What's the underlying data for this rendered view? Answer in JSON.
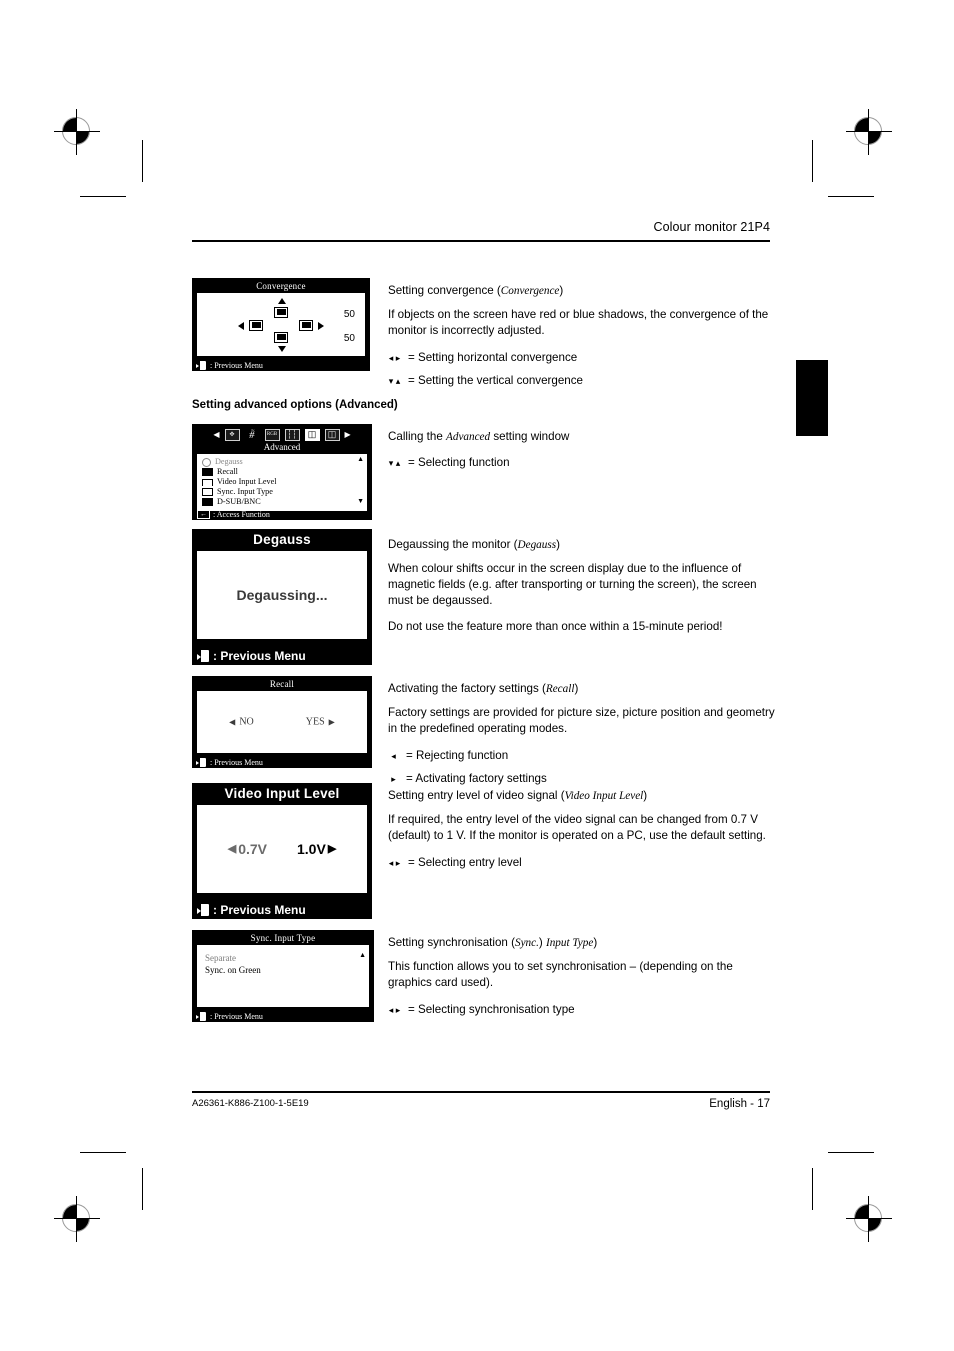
{
  "header": {
    "title": "Colour monitor 21P4"
  },
  "footer": {
    "part_number": "A26361-K886-Z100-1-5E19",
    "page_label": "English - 17"
  },
  "section_heading": "Setting advanced options (Advanced)",
  "sections": [
    {
      "id": "convergence",
      "osd": {
        "title": "Convergence",
        "value_top": "50",
        "value_bottom": "50",
        "footer": ": Previous Menu"
      },
      "heading_plain": "Setting convergence (",
      "heading_italic": "Convergence",
      "heading_close": ")",
      "body": "If objects on the screen have red or blue shadows, the convergence of the monitor is incorrectly adjusted.",
      "keys": [
        {
          "glyphs": "◂ ▸",
          "text": "= Setting horizontal convergence"
        },
        {
          "glyphs": "▾ ▴",
          "text": "= Setting the vertical convergence"
        }
      ]
    },
    {
      "id": "advanced",
      "osd": {
        "menu_label": "Advanced",
        "icons": [
          "left-arrow-icon",
          "picture-size-icon",
          "picture-position-icon",
          "rgb-colour-icon",
          "moire-icon",
          "advanced-icon",
          "osd-position-icon",
          "right-arrow-icon"
        ],
        "icon_glyphs": [
          "◀",
          "✥",
          "✤",
          "RGB",
          "⦀",
          "◰",
          "◳",
          "▶"
        ],
        "items": [
          {
            "label": "Degauss",
            "selected": false
          },
          {
            "label": "Recall",
            "selected": true
          },
          {
            "label": "Video Input Level",
            "selected": true
          },
          {
            "label": "Sync. Input Type",
            "selected": true
          },
          {
            "label": "D-SUB/BNC",
            "selected": true
          }
        ],
        "footer": ": Access Function"
      },
      "heading_plain": "Calling the ",
      "heading_italic": "Advanced",
      "heading_close": " setting window",
      "body": "",
      "keys": [
        {
          "glyphs": "▾ ▴",
          "text": "= Selecting function"
        }
      ]
    },
    {
      "id": "degauss",
      "osd": {
        "title": "Degauss",
        "message": "Degaussing...",
        "footer": ": Previous Menu"
      },
      "heading_plain": "Degaussing the monitor (",
      "heading_italic": "Degauss",
      "heading_close": ")",
      "body": "When colour shifts occur in the screen display due to the influence of magnetic fields (e.g. after transporting or turning the screen), the screen must be degaussed.",
      "body2": "Do not use the feature more than once within a 15-minute period!",
      "keys": []
    },
    {
      "id": "recall",
      "osd": {
        "title": "Recall",
        "option_no": "NO",
        "option_yes": "YES",
        "footer": ": Previous Menu"
      },
      "heading_plain": "Activating the factory settings (",
      "heading_italic": "Recall",
      "heading_close": ")",
      "body": "Factory settings are provided for picture size, picture position and geometry in the predefined operating modes.",
      "keys": [
        {
          "glyphs": "◂",
          "text": "= Rejecting function"
        },
        {
          "glyphs": "▸",
          "text": "= Activating factory settings"
        }
      ]
    },
    {
      "id": "video-input-level",
      "osd": {
        "title": "Video Input Level",
        "option_a": "0.7V",
        "option_b": "1.0V",
        "footer": ": Previous Menu"
      },
      "heading_plain": "Setting entry level of video signal (",
      "heading_italic": "Video Input Level",
      "heading_close": ")",
      "body": "If required, the entry level of the video signal can be changed from 0.7 V (default) to 1 V. If the monitor is operated on a PC, use the default setting.",
      "keys": [
        {
          "glyphs": "◂ ▸",
          "text": "= Selecting entry level"
        }
      ]
    },
    {
      "id": "sync-input-type",
      "osd": {
        "title": "Sync. Input Type",
        "option_a": "Separate",
        "option_b": "Sync. on Green",
        "footer": ": Previous Menu"
      },
      "heading_plain": "Setting synchronisation (",
      "heading_italic": "Sync.",
      "heading_italic2": "Input Type",
      "heading_close": ")",
      "body": "This function allows you to set synchronisation – (depending on the graphics card used).",
      "keys": [
        {
          "glyphs": "◂ ▸",
          "text": "= Selecting synchronisation type"
        }
      ]
    }
  ],
  "colors": {
    "ink": "#000000",
    "paper": "#ffffff",
    "osd_background": "#000000",
    "osd_screen": "#ffffff"
  }
}
